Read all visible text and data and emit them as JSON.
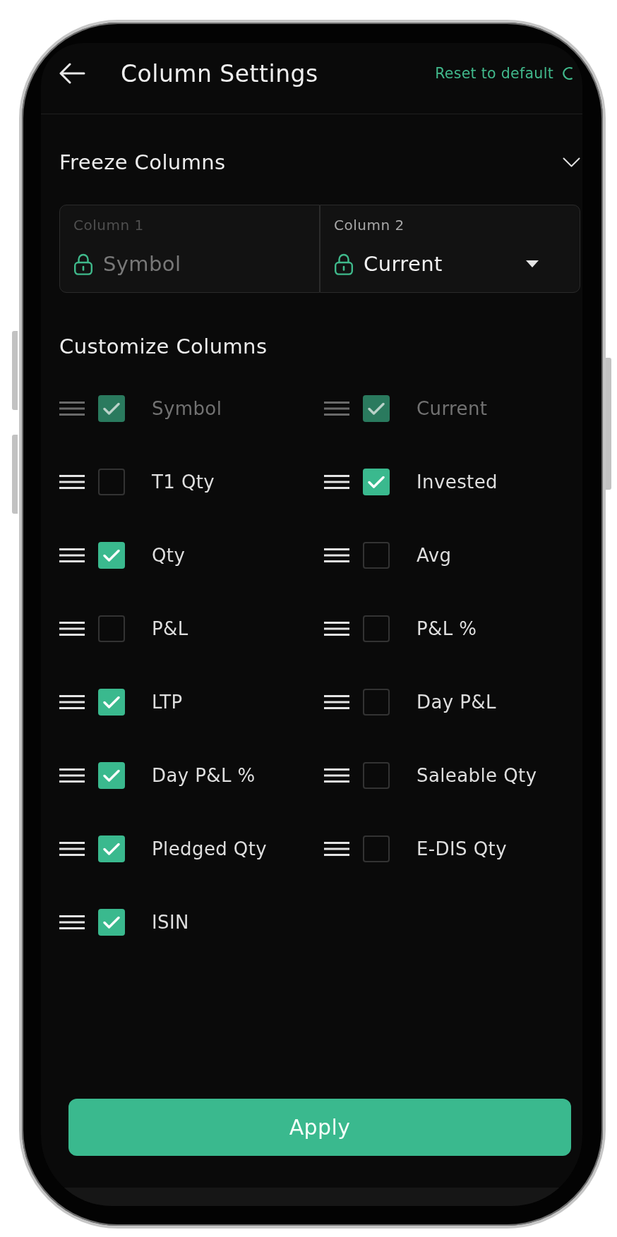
{
  "header": {
    "title": "Column Settings",
    "reset_label": "Reset to default"
  },
  "freeze_section": {
    "title": "Freeze Columns",
    "fields": [
      {
        "label": "Column 1",
        "value": "Symbol",
        "disabled": true
      },
      {
        "label": "Column 2",
        "value": "Current",
        "disabled": false
      }
    ]
  },
  "customize_section": {
    "title": "Customize Columns",
    "columns": [
      {
        "label": "Symbol",
        "checked": true,
        "disabled": true
      },
      {
        "label": "Current",
        "checked": true,
        "disabled": true
      },
      {
        "label": "T1 Qty",
        "checked": false,
        "disabled": false
      },
      {
        "label": "Invested",
        "checked": true,
        "disabled": false
      },
      {
        "label": "Qty",
        "checked": true,
        "disabled": false
      },
      {
        "label": "Avg",
        "checked": false,
        "disabled": false
      },
      {
        "label": "P&L",
        "checked": false,
        "disabled": false
      },
      {
        "label": "P&L %",
        "checked": false,
        "disabled": false
      },
      {
        "label": "LTP",
        "checked": true,
        "disabled": false
      },
      {
        "label": "Day P&L",
        "checked": false,
        "disabled": false
      },
      {
        "label": "Day P&L %",
        "checked": true,
        "disabled": false
      },
      {
        "label": "Saleable Qty",
        "checked": false,
        "disabled": false
      },
      {
        "label": "Pledged Qty",
        "checked": true,
        "disabled": false
      },
      {
        "label": "E-DIS Qty",
        "checked": false,
        "disabled": false
      },
      {
        "label": "ISIN",
        "checked": true,
        "disabled": false
      }
    ]
  },
  "apply_button": {
    "label": "Apply"
  }
}
